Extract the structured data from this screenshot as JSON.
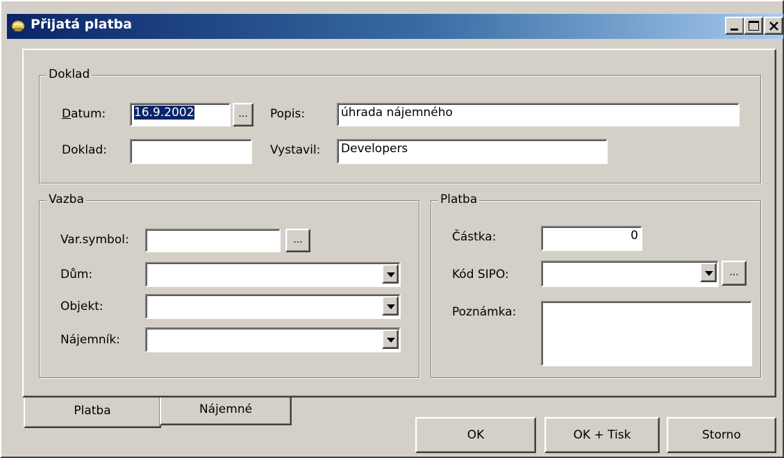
{
  "window": {
    "title": "Přijatá platba"
  },
  "doklad_group": {
    "legend": "Doklad",
    "datum_label": "Datum:",
    "datum_value": "16.9.2002",
    "doklad_label": "Doklad:",
    "doklad_value": "",
    "popis_label": "Popis:",
    "popis_value": "úhrada nájemného",
    "vystavil_label": "Vystavil:",
    "vystavil_value": "Developers",
    "browse_label": "..."
  },
  "vazba_group": {
    "legend": "Vazba",
    "varsymbol_label": "Var.symbol:",
    "varsymbol_value": "",
    "dum_label": "Dům:",
    "dum_value": "",
    "objekt_label": "Objekt:",
    "objekt_value": "",
    "najemnik_label": "Nájemník:",
    "najemnik_value": "",
    "browse_label": "..."
  },
  "platba_group": {
    "legend": "Platba",
    "castka_label": "Částka:",
    "castka_value": "0",
    "sipo_label": "Kód SIPO:",
    "sipo_value": "",
    "poznamka_label": "Poznámka:",
    "poznamka_value": "",
    "browse_label": "..."
  },
  "tabs": [
    {
      "label": "Platba",
      "active": true
    },
    {
      "label": "Nájemné",
      "active": false
    }
  ],
  "buttons": {
    "ok": "OK",
    "ok_tisk": "OK + Tisk",
    "storno": "Storno"
  },
  "colors": {
    "titlebar_start": "#0a246a",
    "titlebar_end": "#a6caf0",
    "face": "#d4d0c8"
  }
}
